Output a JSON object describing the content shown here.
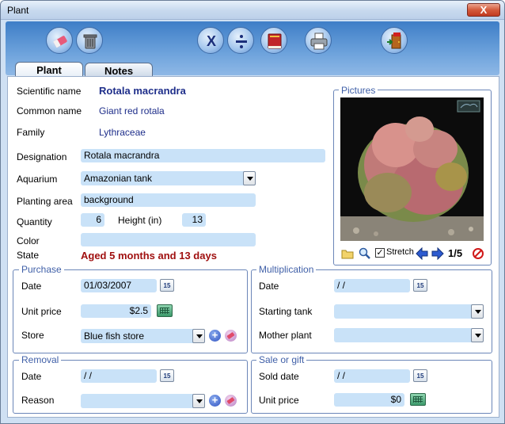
{
  "window": {
    "title": "Plant",
    "close_label": "X"
  },
  "toolbar": {
    "buttons": [
      {
        "name": "eraser-icon"
      },
      {
        "name": "trash-icon"
      },
      {
        "name": "cancel-icon"
      },
      {
        "name": "divide-icon"
      },
      {
        "name": "book-icon"
      },
      {
        "name": "printer-icon"
      },
      {
        "name": "exit-door-icon"
      }
    ]
  },
  "tabs": [
    {
      "label": "Plant",
      "active": true
    },
    {
      "label": "Notes",
      "active": false
    }
  ],
  "plant": {
    "scientific_name_label": "Scientific name",
    "scientific_name": "Rotala macrandra",
    "common_name_label": "Common name",
    "common_name": "Giant red rotala",
    "family_label": "Family",
    "family": "Lythraceae",
    "designation_label": "Designation",
    "designation": "Rotala macrandra",
    "aquarium_label": "Aquarium",
    "aquarium": "Amazonian tank",
    "planting_area_label": "Planting area",
    "planting_area": "background",
    "quantity_label": "Quantity",
    "quantity": "6",
    "height_label": "Height (in)",
    "height": "13",
    "color_label": "Color",
    "color": "",
    "state_label": "State",
    "state": "Aged 5 months and 13 days"
  },
  "pictures": {
    "title": "Pictures",
    "stretch_label": "Stretch",
    "stretch_checked": true,
    "counter": "1/5"
  },
  "purchase": {
    "title": "Purchase",
    "date_label": "Date",
    "date": "01/03/2007",
    "unit_price_label": "Unit price",
    "unit_price": "$2.5",
    "store_label": "Store",
    "store": "Blue fish store"
  },
  "multiplication": {
    "title": "Multiplication",
    "date_label": "Date",
    "date": " /  /",
    "starting_tank_label": "Starting tank",
    "starting_tank": "",
    "mother_plant_label": "Mother plant",
    "mother_plant": ""
  },
  "removal": {
    "title": "Removal",
    "date_label": "Date",
    "date": " /  /",
    "reason_label": "Reason",
    "reason": ""
  },
  "sale": {
    "title": "Sale or gift",
    "sold_date_label": "Sold date",
    "sold_date": " /  /",
    "unit_price_label": "Unit price",
    "unit_price": "$0"
  },
  "calendar_glyph": "15",
  "add_glyph": "+",
  "colors": {
    "state_text": "#a01010",
    "value_text": "#1e2e8a",
    "field_bg": "#c9e2f8",
    "group_title": "#4060a8"
  }
}
